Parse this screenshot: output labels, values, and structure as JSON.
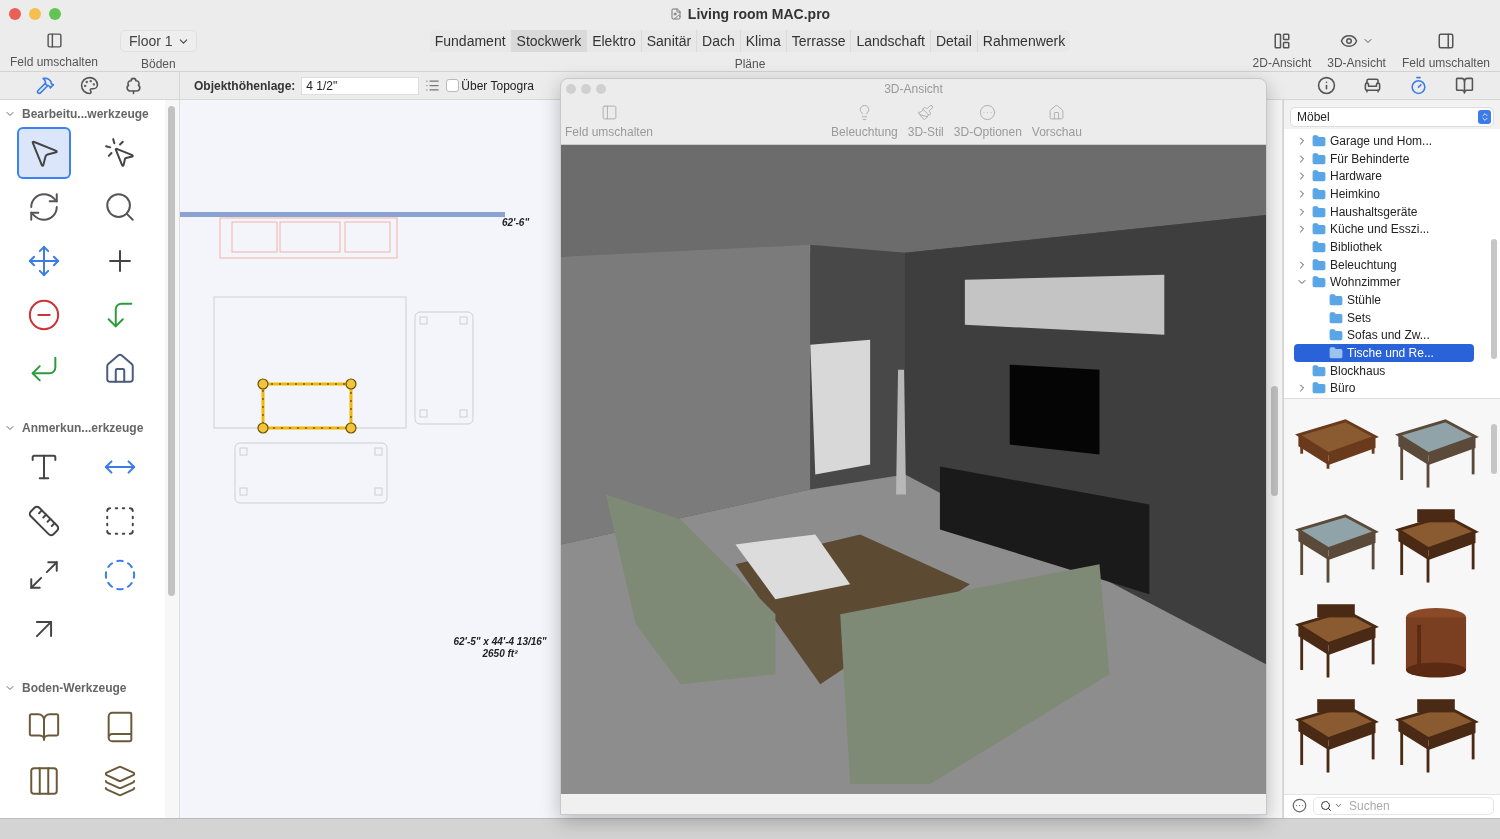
{
  "window": {
    "title": "Living room MAC.pro"
  },
  "toolbar": {
    "left": {
      "label": "Feld umschalten"
    },
    "floor_select": {
      "value": "Floor 1",
      "label": "Böden"
    },
    "plans": {
      "label": "Pläne",
      "tabs": [
        {
          "label": "Fundament",
          "selected": false
        },
        {
          "label": "Stockwerk",
          "selected": true
        },
        {
          "label": "Elektro",
          "selected": false
        },
        {
          "label": "Sanitär",
          "selected": false
        },
        {
          "label": "Dach",
          "selected": false
        },
        {
          "label": "Klima",
          "selected": false
        },
        {
          "label": "Terrasse",
          "selected": false
        },
        {
          "label": "Landschaft",
          "selected": false
        },
        {
          "label": "Detail",
          "selected": false
        },
        {
          "label": "Rahmenwerk",
          "selected": false
        }
      ]
    },
    "right": [
      {
        "label": "2D-Ansicht"
      },
      {
        "label": "3D-Ansicht"
      },
      {
        "label": "Feld umschalten"
      }
    ]
  },
  "left_tabs": [
    {
      "selected": true
    },
    {
      "selected": false
    },
    {
      "selected": false
    }
  ],
  "tool_groups": [
    {
      "title": "Bearbeitu...werkzeuge",
      "expanded": true,
      "tools": [
        {
          "selected": true
        },
        {
          "selected": false
        },
        {
          "selected": false
        },
        {
          "selected": false
        },
        {
          "selected": false
        },
        {
          "selected": false
        },
        {
          "selected": false
        },
        {
          "selected": false
        },
        {
          "selected": false
        },
        {
          "selected": false
        }
      ]
    },
    {
      "title": "Anmerkun...erkzeuge",
      "expanded": true,
      "tools": [
        {
          "selected": false
        },
        {
          "selected": false
        },
        {
          "selected": false
        },
        {
          "selected": false
        },
        {
          "selected": false
        },
        {
          "selected": false
        },
        {
          "selected": false
        }
      ]
    },
    {
      "title": "Boden-Werkzeuge",
      "expanded": true,
      "tools": [
        {
          "selected": false
        },
        {
          "selected": false
        },
        {
          "selected": false
        },
        {
          "selected": false
        }
      ]
    }
  ],
  "options_bar": {
    "label": "Objekthöhenlage:",
    "value": "4 1/2\"",
    "checkbox": {
      "label": "Über Topogra",
      "checked": false
    }
  },
  "plan": {
    "dimension": "62'-6\"",
    "area_size": "62'-5\" x 44'-4 13/16\"",
    "area": "2650 ft²"
  },
  "view_3d": {
    "title": "3D-Ansicht",
    "toolbar": [
      {
        "label": "Feld umschalten"
      },
      {
        "label": "Beleuchtung"
      },
      {
        "label": "3D-Stil"
      },
      {
        "label": "3D-Optionen"
      },
      {
        "label": "Vorschau"
      }
    ]
  },
  "library": {
    "tabs": [
      {
        "selected": false
      },
      {
        "selected": false
      },
      {
        "selected": true
      },
      {
        "selected": false
      }
    ],
    "category": "Möbel",
    "tree": [
      {
        "label": "Garage und Hom...",
        "kind": "group",
        "expanded": false,
        "selected": false
      },
      {
        "label": "Für Behinderte",
        "kind": "group",
        "expanded": false,
        "selected": false
      },
      {
        "label": "Hardware",
        "kind": "group",
        "expanded": false,
        "selected": false
      },
      {
        "label": "Heimkino",
        "kind": "group",
        "expanded": false,
        "selected": false
      },
      {
        "label": "Haushaltsgeräte",
        "kind": "group",
        "expanded": false,
        "selected": false
      },
      {
        "label": "Küche und Esszi...",
        "kind": "group",
        "expanded": false,
        "selected": false
      },
      {
        "label": "Bibliothek",
        "kind": "leaf",
        "selected": false
      },
      {
        "label": "Beleuchtung",
        "kind": "group",
        "expanded": false,
        "selected": false
      },
      {
        "label": "Wohnzimmer",
        "kind": "group",
        "expanded": true,
        "selected": false,
        "children": [
          {
            "label": "Stühle",
            "selected": false
          },
          {
            "label": "Sets",
            "selected": false
          },
          {
            "label": "Sofas und Zw...",
            "selected": false
          },
          {
            "label": "Tische und Re...",
            "selected": true
          }
        ]
      },
      {
        "label": "Blockhaus",
        "kind": "leaf",
        "selected": false
      },
      {
        "label": "Büro",
        "kind": "group",
        "expanded": false,
        "selected": false
      }
    ],
    "search": {
      "placeholder": "Suchen"
    }
  }
}
